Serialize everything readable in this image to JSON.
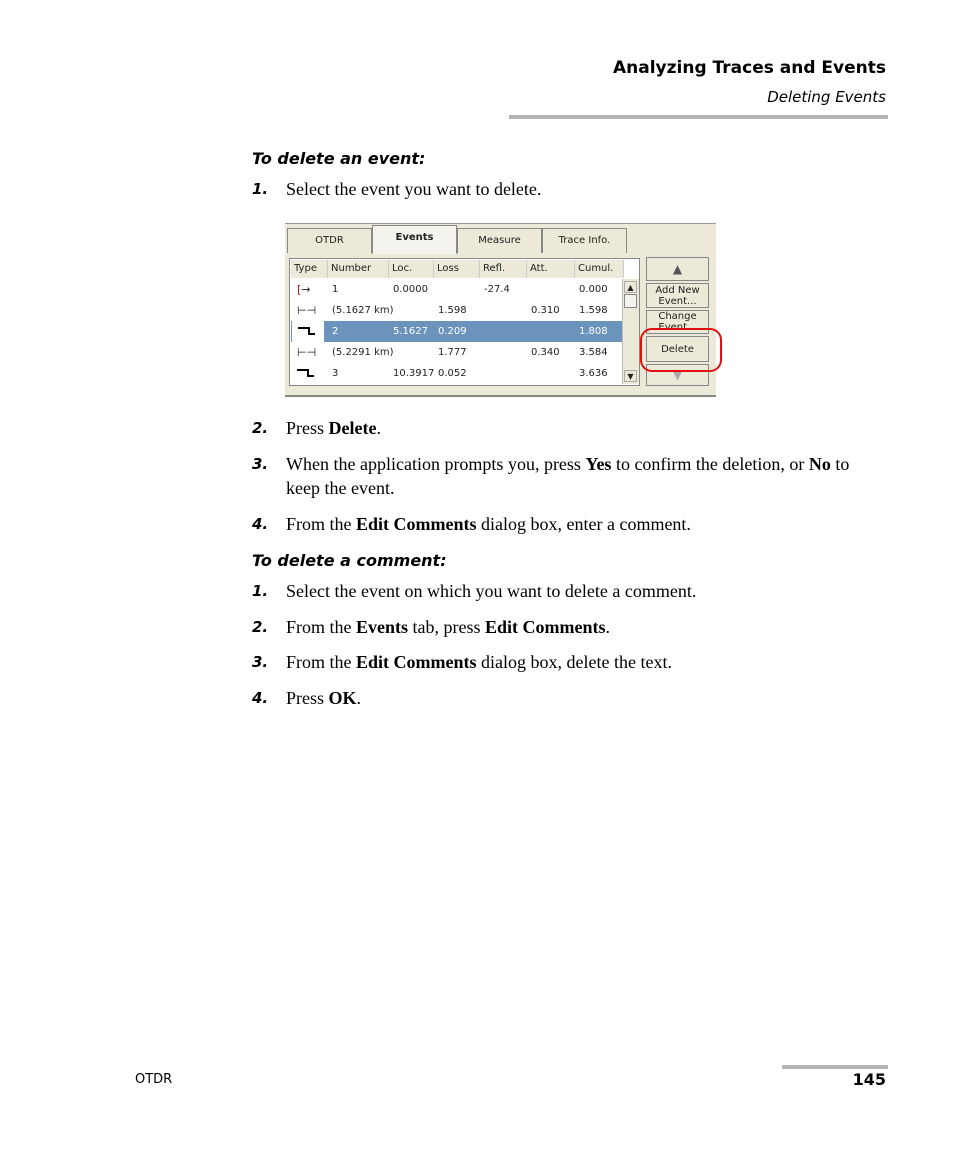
{
  "header": {
    "title": "Analyzing Traces and Events",
    "subtitle": "Deleting Events"
  },
  "sections": [
    {
      "title": "To delete an event:",
      "steps": [
        {
          "n": "1.",
          "parts": [
            "Select the event you want to delete."
          ]
        },
        {
          "n": "2.",
          "parts": [
            "Press ",
            "Delete",
            "."
          ]
        },
        {
          "n": "3.",
          "parts": [
            "When the application prompts you, press ",
            "Yes",
            " to confirm the deletion, or ",
            "No",
            " to keep the event."
          ]
        },
        {
          "n": "4.",
          "parts": [
            "From the ",
            "Edit Comments",
            " dialog box, enter a comment."
          ]
        }
      ]
    },
    {
      "title": "To delete a comment:",
      "steps": [
        {
          "n": "1.",
          "parts": [
            "Select the event on which you want to delete a comment."
          ]
        },
        {
          "n": "2.",
          "parts": [
            "From the ",
            "Events",
            " tab, press ",
            "Edit Comments",
            "."
          ]
        },
        {
          "n": "3.",
          "parts": [
            "From the ",
            "Edit Comments",
            " dialog box, delete the text."
          ]
        },
        {
          "n": "4.",
          "parts": [
            "Press ",
            "OK",
            "."
          ]
        }
      ]
    }
  ],
  "screenshot": {
    "tabs": [
      "OTDR",
      "Events",
      "Measure",
      "Trace Info."
    ],
    "active_tab": "Events",
    "columns": [
      "Type",
      "Number",
      "Loc.",
      "Loss",
      "Refl.",
      "Att.",
      "Cumul."
    ],
    "rows": [
      {
        "type": "launch-icon",
        "number": "1",
        "loc": "0.0000",
        "loss": "",
        "refl": "-27.4",
        "att": "",
        "cumul": "0.000"
      },
      {
        "type": "span-icon",
        "number": "(5.1627 km)",
        "loc": "",
        "loss": "1.598",
        "refl": "",
        "att": "0.310",
        "cumul": "1.598"
      },
      {
        "type": "step-icon",
        "number": "2",
        "loc": "5.1627",
        "loss": "0.209",
        "refl": "",
        "att": "",
        "cumul": "1.808",
        "selected": true
      },
      {
        "type": "span-icon",
        "number": "(5.2291 km)",
        "loc": "",
        "loss": "1.777",
        "refl": "",
        "att": "0.340",
        "cumul": "3.584"
      },
      {
        "type": "step-icon",
        "number": "3",
        "loc": "10.3917",
        "loss": "0.052",
        "refl": "",
        "att": "",
        "cumul": "3.636"
      }
    ],
    "buttons": {
      "add": "Add New Event...",
      "change": "Change Event...",
      "delete": "Delete"
    },
    "selection_color": "#6b93bb",
    "highlight_color": "#e01010"
  },
  "footer": {
    "left": "OTDR",
    "page": "145"
  }
}
